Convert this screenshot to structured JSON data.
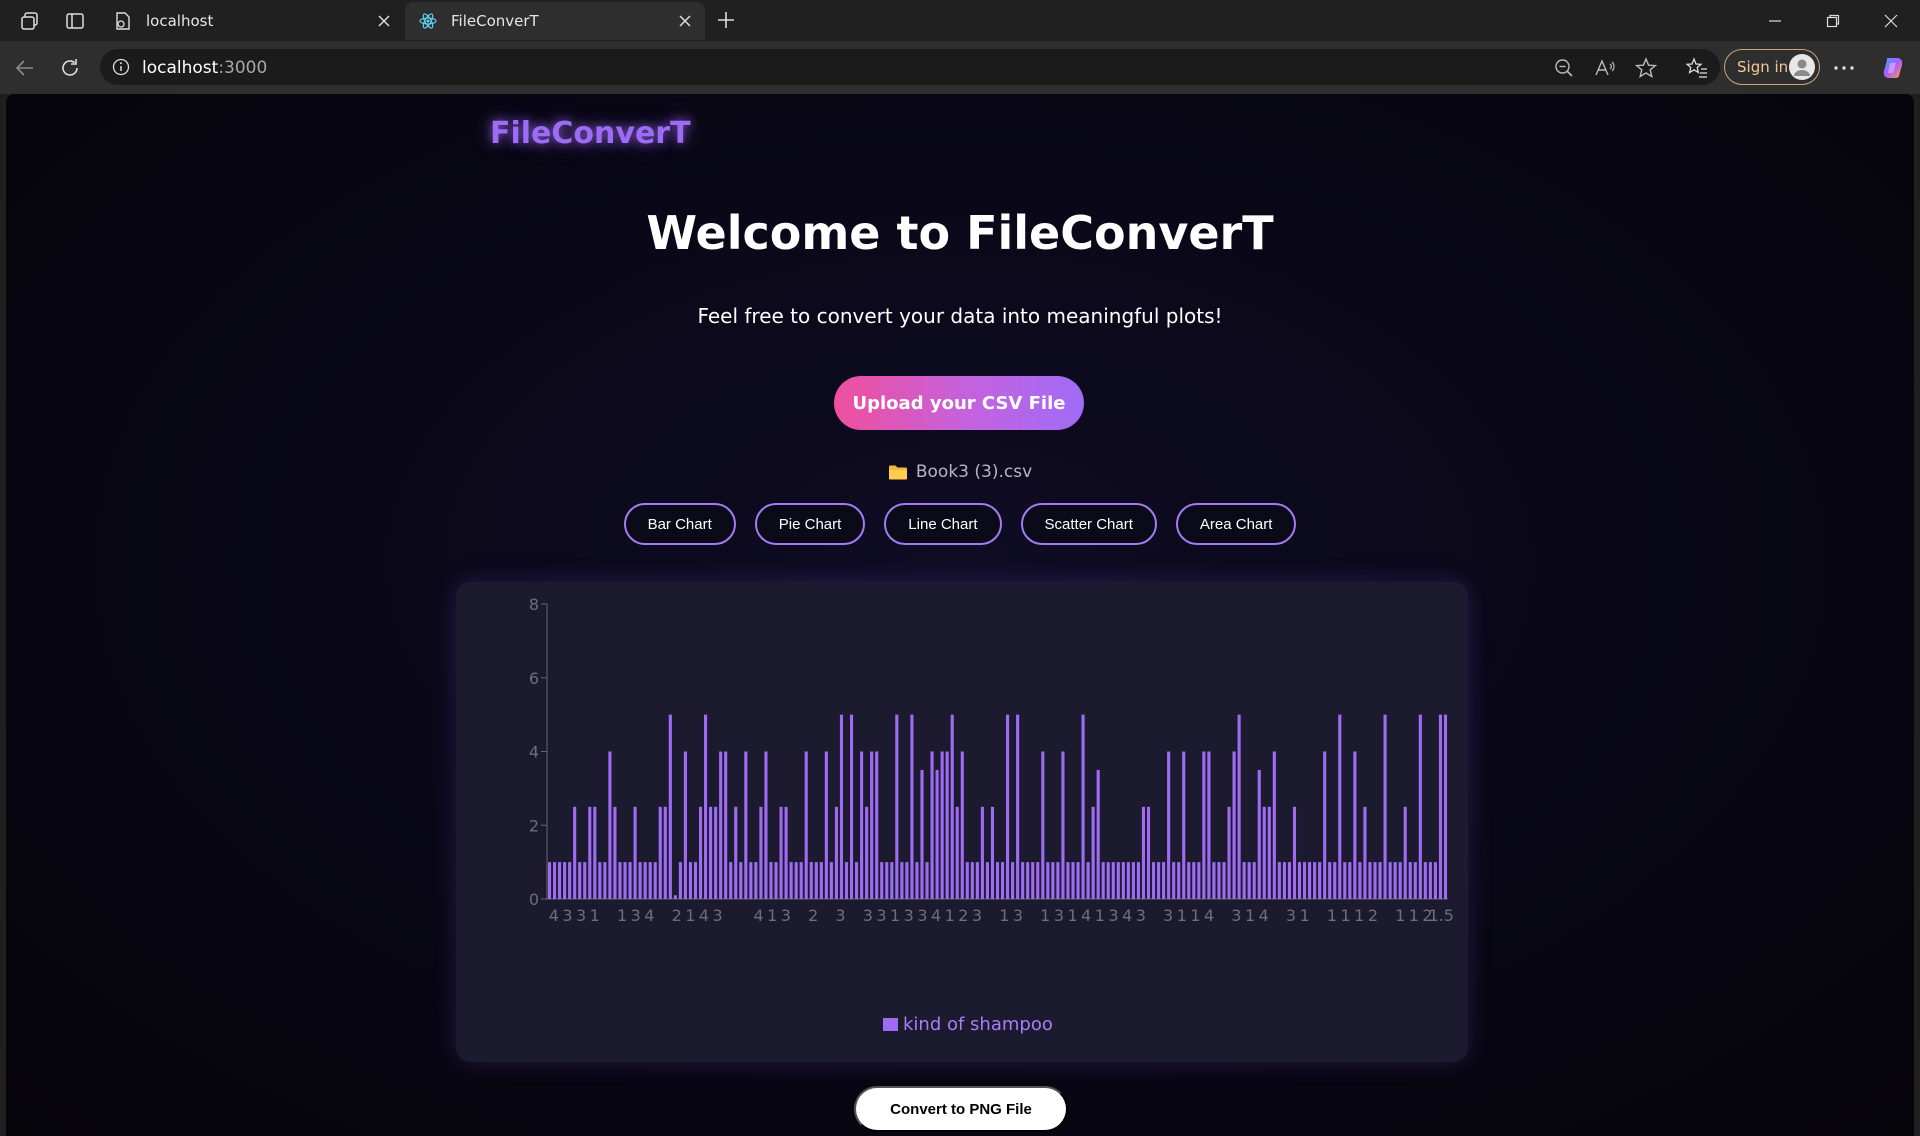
{
  "browser": {
    "tabs": [
      {
        "title": "localhost",
        "active": false,
        "favicon": "page-icon"
      },
      {
        "title": "FileConverT",
        "active": true,
        "favicon": "react-icon"
      }
    ],
    "address": {
      "host": "localhost",
      "port": ":3000"
    },
    "sign_in_label": "Sign in"
  },
  "page": {
    "brand": "FileConverT",
    "title": "Welcome to FileConverT",
    "subtitle": "Feel free to convert your data into meaningful plots!",
    "upload_label": "Upload your CSV File",
    "file_name": "Book3 (3).csv",
    "chart_types": [
      "Bar Chart",
      "Pie Chart",
      "Line Chart",
      "Scatter Chart",
      "Area Chart"
    ],
    "convert_label": "Convert to PNG File"
  },
  "colors": {
    "accent": "#9d6bf5",
    "bar": "#9e6cf2",
    "card": "#1b1a2e"
  },
  "chart_data": {
    "type": "bar",
    "ylim": [
      0,
      8
    ],
    "yticks": [
      0,
      2,
      4,
      6,
      8
    ],
    "legend_position": "bottom",
    "series": [
      {
        "name": "kind of shampoo",
        "values": [
          1,
          1,
          1,
          1,
          1,
          2.5,
          1,
          1,
          2.5,
          2.5,
          1,
          1,
          4,
          2.5,
          1,
          1,
          1,
          2.5,
          1,
          1,
          1,
          1,
          2.5,
          2.5,
          5,
          0.1,
          1,
          4,
          1,
          1,
          2.5,
          5,
          2.5,
          2.5,
          4,
          4,
          1,
          2.5,
          1,
          4,
          1,
          1,
          2.5,
          4,
          1,
          1,
          2.5,
          2.5,
          1,
          1,
          1,
          4,
          1,
          1,
          1,
          4,
          1,
          2.5,
          5,
          1,
          5,
          1,
          4,
          2.5,
          4,
          4,
          1,
          1,
          1,
          5,
          1,
          1,
          5,
          1,
          3.5,
          1,
          4,
          3.5,
          4,
          4,
          5,
          2.5,
          4,
          1,
          1,
          1,
          2.5,
          1,
          2.5,
          1,
          1,
          5,
          1,
          5,
          1,
          1,
          1,
          1,
          4,
          1,
          1,
          1,
          4,
          1,
          1,
          1,
          5,
          1,
          2.5,
          3.5,
          1,
          1,
          1,
          1,
          1,
          1,
          1,
          1,
          2.5,
          2.5,
          1,
          1,
          1,
          4,
          1,
          1,
          4,
          1,
          1,
          1,
          4,
          4,
          1,
          1,
          1,
          2.5,
          4,
          5,
          1,
          1,
          1,
          3.5,
          2.5,
          2.5,
          4,
          1,
          1,
          1,
          2.5,
          1,
          1,
          1,
          1,
          1,
          4,
          1,
          1,
          5,
          1,
          1,
          4,
          1,
          2.5,
          1,
          1,
          1,
          5,
          1,
          1,
          1,
          2.5,
          1,
          1,
          5,
          1,
          1,
          1,
          5,
          5
        ]
      }
    ],
    "x_tick_labels": [
      "4",
      "3",
      "3",
      "1",
      "",
      "1",
      "3",
      "4",
      "",
      "2",
      "1",
      "4",
      "3",
      "",
      "",
      "4",
      "1",
      "3",
      "",
      "2",
      "",
      "3",
      "",
      "3",
      "3",
      "1",
      "3",
      "3",
      "4",
      "1",
      "2",
      "3",
      "",
      "1",
      "3",
      "",
      "1",
      "3",
      "1",
      "4",
      "1",
      "3",
      "4",
      "3",
      "",
      "3",
      "1",
      "1",
      "4",
      "",
      "3",
      "1",
      "4",
      "",
      "3",
      "1",
      "",
      "1",
      "1",
      "1",
      "2",
      "",
      "1",
      "1",
      "2",
      "1.5"
    ]
  }
}
